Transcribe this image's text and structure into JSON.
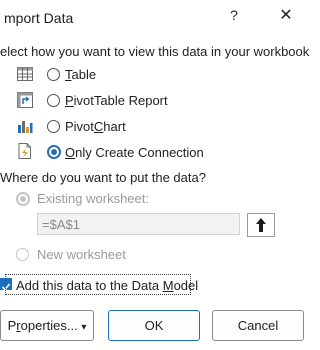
{
  "dialog": {
    "title": "mport Data",
    "help_glyph": "?",
    "close_glyph": "✕"
  },
  "view_section": {
    "question": "elect how you want to view this data in your workbook",
    "options": [
      {
        "icon": "table-icon",
        "accel": "T",
        "rest": "able",
        "checked": false
      },
      {
        "icon": "pivottable-icon",
        "accel": "P",
        "rest": "ivotTable Report",
        "checked": false
      },
      {
        "icon": "pivotchart-icon",
        "pre": "Pivot",
        "accel": "C",
        "rest": "hart",
        "checked": false
      },
      {
        "icon": "connection-icon",
        "accel": "O",
        "rest": "nly Create Connection",
        "checked": true
      }
    ]
  },
  "location_section": {
    "question": "Where do you want to put the data?",
    "existing_label": "Existing worksheet:",
    "existing_value": "=$A$1",
    "collapse_glyph": "⬆",
    "new_label": "New worksheet",
    "existing_checked": true,
    "enabled": false
  },
  "data_model": {
    "pre": "Add this data to the Data ",
    "accel": "M",
    "rest": "odel",
    "checked": true
  },
  "buttons": {
    "properties": {
      "accel": "r",
      "pre": "P",
      "rest": "operties...",
      "arrow": "▾"
    },
    "ok": "OK",
    "cancel": "Cancel"
  },
  "colors": {
    "accent": "#1f6fc0",
    "disabled": "#9a9a9a"
  }
}
